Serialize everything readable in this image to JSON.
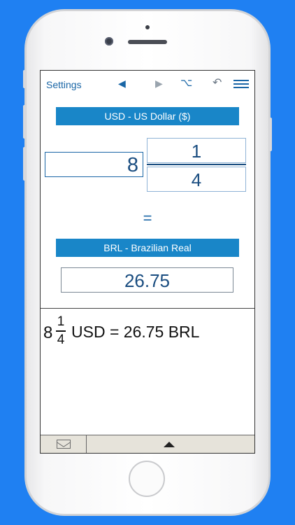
{
  "toolbar": {
    "settings_label": "Settings",
    "icons": [
      "triangle-left-icon",
      "triangle-right-icon",
      "option-key-icon",
      "undo-icon",
      "menu-icon"
    ]
  },
  "from_currency": {
    "label": "USD - US Dollar ($)"
  },
  "amount": {
    "whole": "8",
    "numerator": "1",
    "denominator": "4"
  },
  "equals_sign": "=",
  "to_currency": {
    "label": "BRL - Brazilian Real"
  },
  "result": {
    "value": "26.75"
  },
  "expression": {
    "whole": "8",
    "numerator": "1",
    "denominator": "4",
    "text": "USD = 26.75 BRL"
  },
  "bottom_bar": {
    "icons": [
      "mail-icon",
      "expand-up-icon"
    ]
  },
  "colors": {
    "background": "#1f80f2",
    "accent": "#1986c8",
    "text_blue": "#1a66a6"
  }
}
